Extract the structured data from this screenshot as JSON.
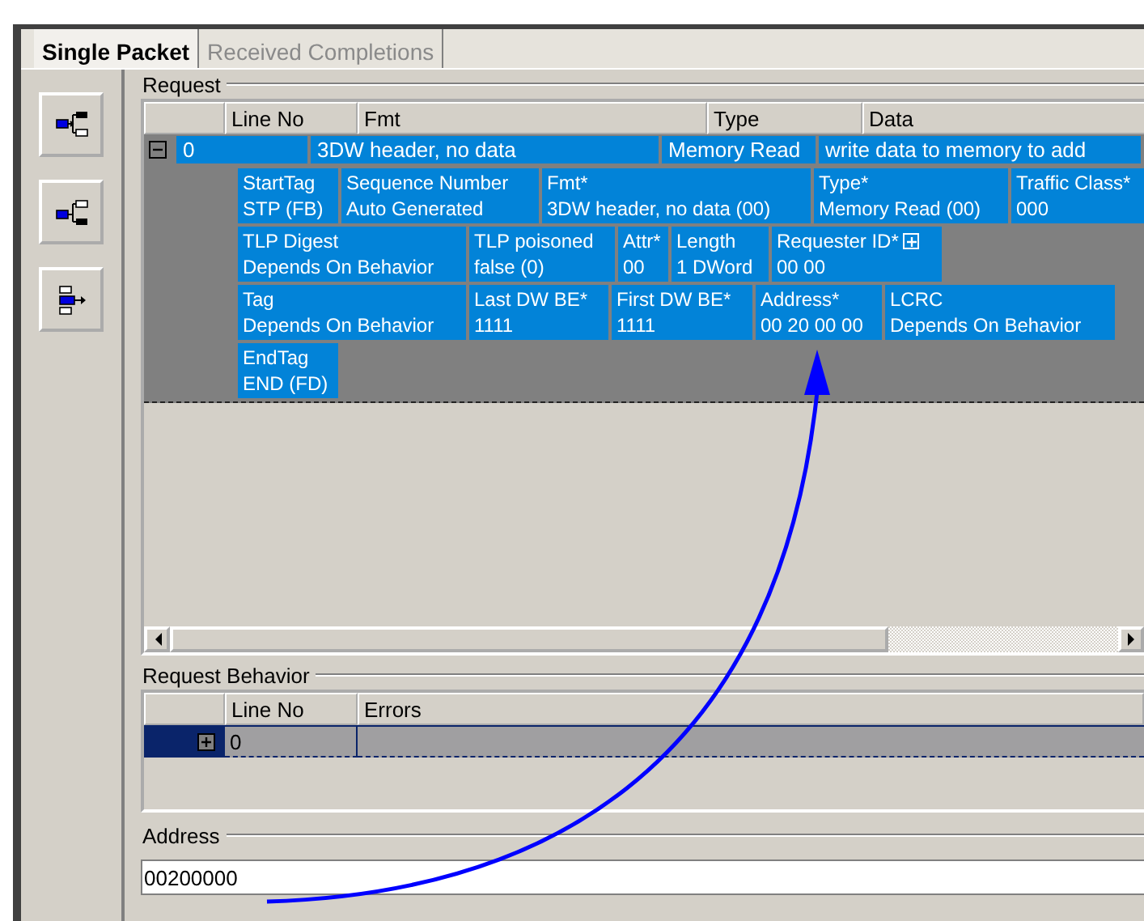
{
  "tabs": [
    {
      "label": "Single Packet",
      "selected": true
    },
    {
      "label": "Received Completions",
      "selected": false
    }
  ],
  "request": {
    "title": "Request",
    "columns": [
      "Line No",
      "Fmt",
      "Type",
      "Data"
    ],
    "row": {
      "expanded": true,
      "cells": [
        "0",
        "3DW header, no data",
        "Memory Read",
        "write data to memory to add"
      ]
    },
    "fields": [
      [
        {
          "label": "StartTag",
          "value": "STP (FB)"
        },
        {
          "label": "Sequence Number",
          "value": "Auto Generated"
        },
        {
          "label": "Fmt*",
          "value": "3DW header, no data (00)"
        },
        {
          "label": "Type*",
          "value": "Memory Read (00)"
        },
        {
          "label": "Traffic Class*",
          "value": "000"
        }
      ],
      [
        {
          "label": "TLP Digest",
          "value": "Depends On Behavior"
        },
        {
          "label": "TLP poisoned",
          "value": "false (0)"
        },
        {
          "label": "Attr*",
          "value": "00"
        },
        {
          "label": "Length",
          "value": "1 DWord"
        },
        {
          "label": "Requester ID*",
          "value": "00 00",
          "expandable": true
        }
      ],
      [
        {
          "label": "Tag",
          "value": "Depends On Behavior"
        },
        {
          "label": "Last DW BE*",
          "value": "1111"
        },
        {
          "label": "First DW BE*",
          "value": "1111"
        },
        {
          "label": "Address*",
          "value": "00 20 00 00"
        },
        {
          "label": "LCRC",
          "value": "Depends On Behavior"
        }
      ],
      [
        {
          "label": "EndTag",
          "value": "END (FD)"
        }
      ]
    ]
  },
  "request_behavior": {
    "title": "Request Behavior",
    "columns": [
      "Line No",
      "Errors"
    ],
    "rows": [
      {
        "expanded": false,
        "selected": true,
        "cells": [
          "0"
        ]
      }
    ]
  },
  "address": {
    "title": "Address",
    "value": "00200000"
  }
}
